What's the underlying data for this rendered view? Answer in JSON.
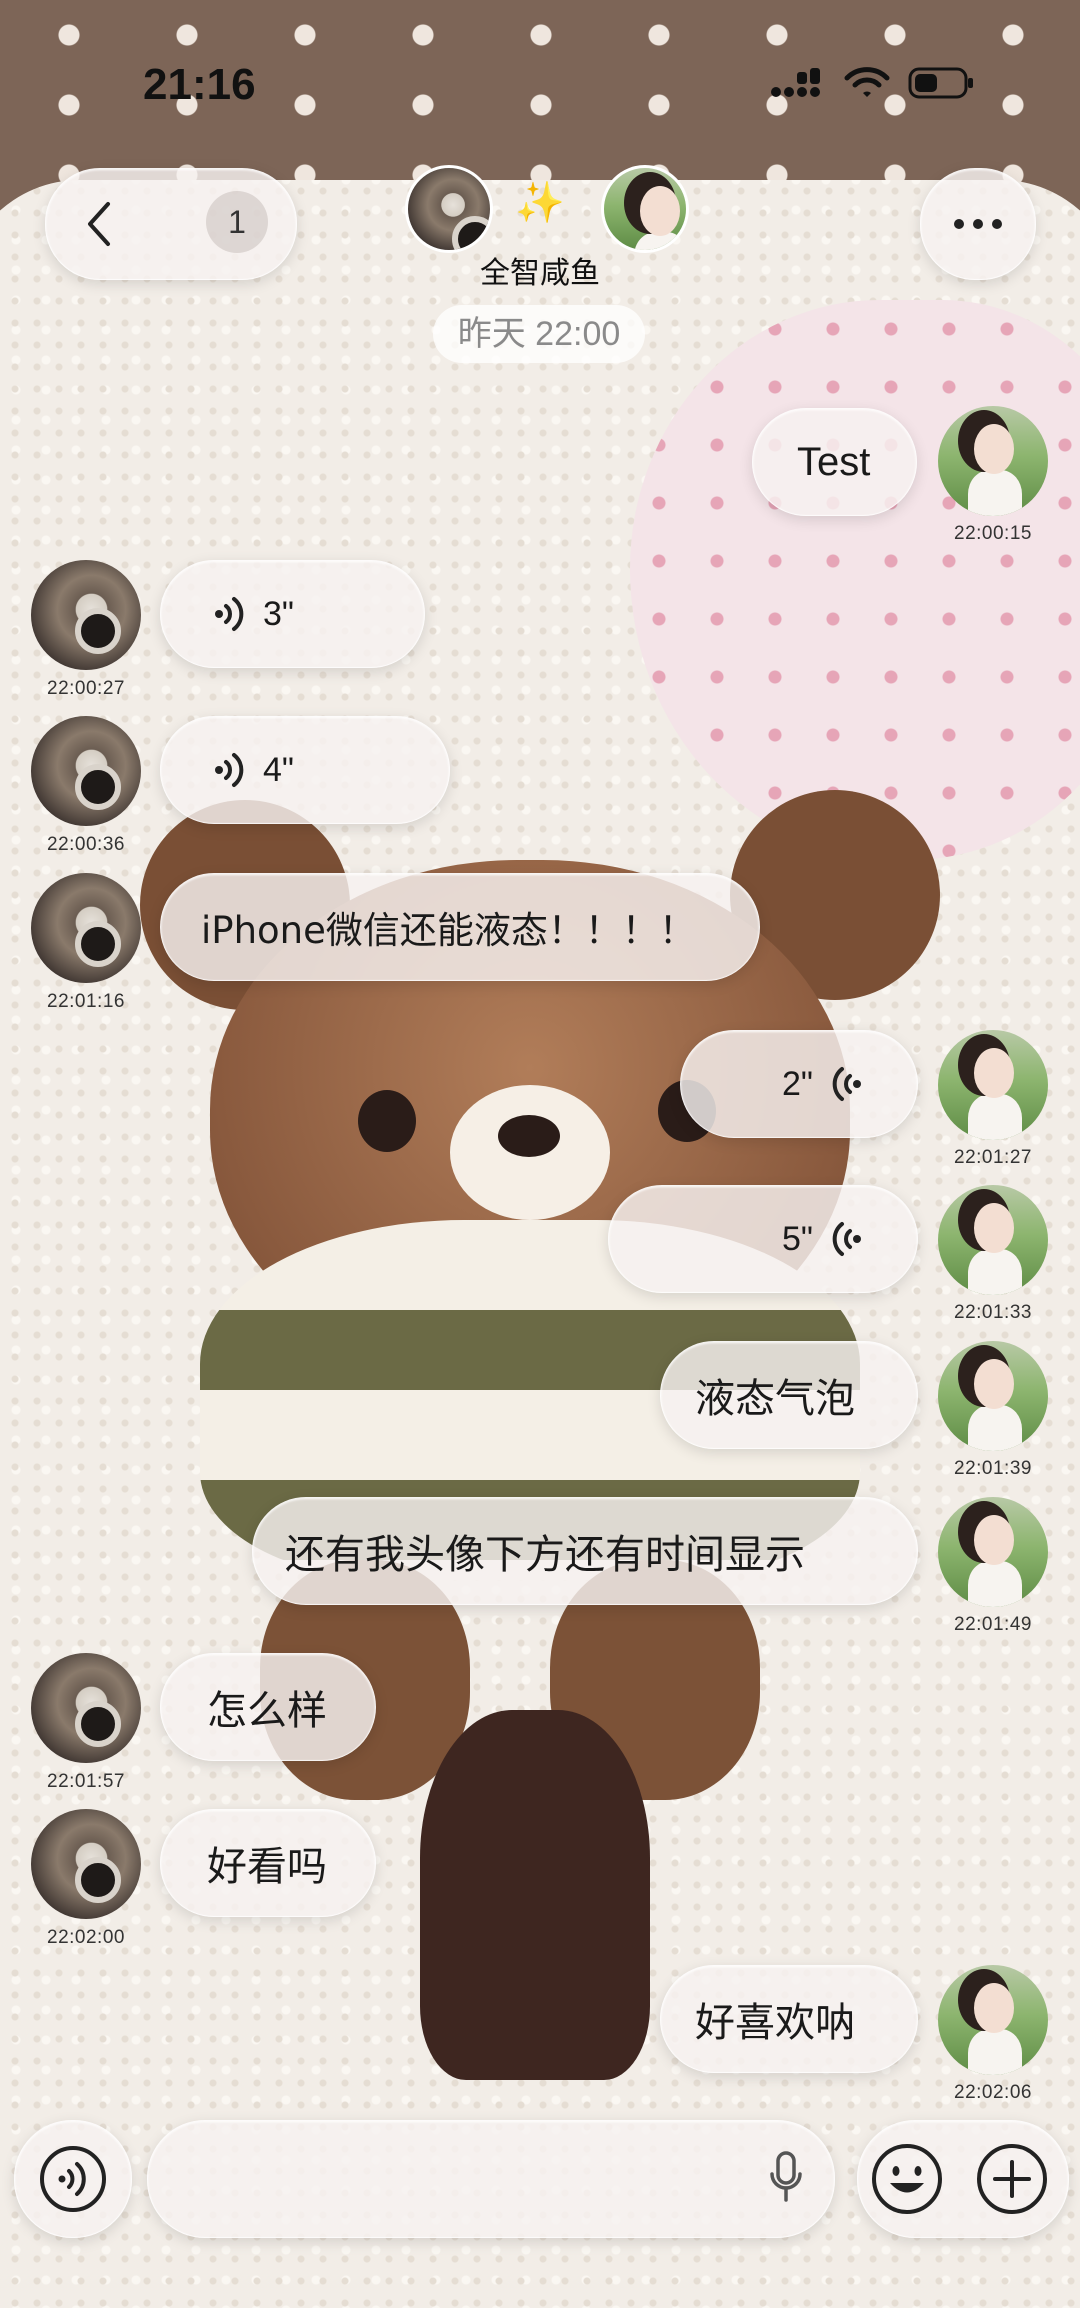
{
  "status_bar": {
    "time": "21:16",
    "icons": [
      "signal-icon",
      "wifi-icon",
      "battery-icon"
    ]
  },
  "header": {
    "back_count": "1",
    "chat_title": "全智咸鱼",
    "sparkle": "✨",
    "more_icon": "more-icon"
  },
  "date_divider": "昨天 22:00",
  "messages": [
    {
      "from": "self",
      "type": "text",
      "text": "Test",
      "time": "22:00:15"
    },
    {
      "from": "friend",
      "type": "voice",
      "duration": "3\"",
      "time": "22:00:27"
    },
    {
      "from": "friend",
      "type": "voice",
      "duration": "4\"",
      "time": "22:00:36"
    },
    {
      "from": "friend",
      "type": "text",
      "text": "iPhone微信还能液态！！！！",
      "time": "22:01:16"
    },
    {
      "from": "self",
      "type": "voice",
      "duration": "2\"",
      "time": "22:01:27"
    },
    {
      "from": "self",
      "type": "voice",
      "duration": "5\"",
      "time": "22:01:33"
    },
    {
      "from": "self",
      "type": "text",
      "text": "液态气泡",
      "time": "22:01:39"
    },
    {
      "from": "self",
      "type": "text",
      "text": "还有我头像下方还有时间显示",
      "time": "22:01:49"
    },
    {
      "from": "friend",
      "type": "text",
      "text": "怎么样",
      "time": "22:01:57"
    },
    {
      "from": "friend",
      "type": "text",
      "text": "好看吗",
      "time": "22:02:00"
    },
    {
      "from": "self",
      "type": "text",
      "text": "好喜欢呐",
      "time": "22:02:06"
    }
  ],
  "input_bar": {
    "placeholder": "",
    "icons": [
      "voice-toggle-icon",
      "mic-icon",
      "emoji-icon",
      "plus-icon"
    ]
  },
  "colors": {
    "bubble_glass": "#f6f2f0",
    "timestamp_text": "#333333",
    "date_text": "#8a8a8a"
  }
}
